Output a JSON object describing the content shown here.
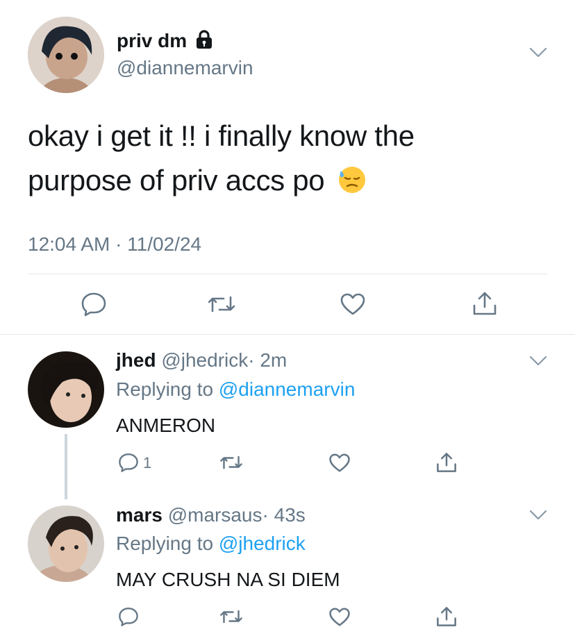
{
  "main_tweet": {
    "display_name": "priv dm",
    "handle": "@diannemarvin",
    "text_line1": "okay i get it !! i finally know the",
    "text_line2": "purpose of priv accs po",
    "emoji": "😓",
    "timestamp": "12:04 AM · 11/02/24"
  },
  "replies": [
    {
      "display_name": "jhed",
      "handle": "@jhedrick",
      "time": "· 2m",
      "replying_prefix": "Replying to",
      "replying_to": "@diannemarvin",
      "text": "ANMERON",
      "reply_count": "1"
    },
    {
      "display_name": "mars",
      "handle": "@marsaus",
      "time": "· 43s",
      "replying_prefix": "Replying to",
      "replying_to": "@jhedrick",
      "text": "MAY CRUSH NA SI DIEM",
      "reply_count": ""
    }
  ],
  "colors": {
    "text": "#14171a",
    "secondary": "#657786",
    "link": "#1da1f2",
    "divider": "#e1e8ed"
  },
  "icons": [
    "chevron-down-icon",
    "lock-icon",
    "reply-icon",
    "retweet-icon",
    "like-icon",
    "share-icon"
  ]
}
